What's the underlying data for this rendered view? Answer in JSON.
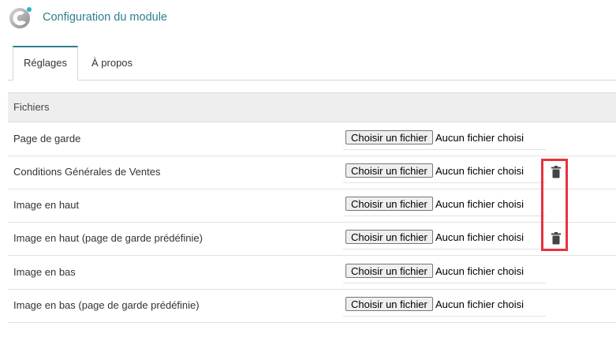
{
  "header": {
    "title": "Configuration du module",
    "logo_icon": "module-logo-icon"
  },
  "tabs": [
    {
      "label": "Réglages",
      "active": true
    },
    {
      "label": "À propos",
      "active": false
    }
  ],
  "section": {
    "title": "Fichiers"
  },
  "rows": [
    {
      "label": "Page de garde",
      "button": "Choisir un fichier",
      "status": "Aucun fichier choisi",
      "has_delete": false
    },
    {
      "label": "Conditions Générales de Ventes",
      "button": "Choisir un fichier",
      "status": "Aucun fichier choisi",
      "has_delete": true
    },
    {
      "label": "Image en haut",
      "button": "Choisir un fichier",
      "status": "Aucun fichier choisi",
      "has_delete": false
    },
    {
      "label": "Image en haut (page de garde prédéfinie)",
      "button": "Choisir un fichier",
      "status": "Aucun fichier choisi",
      "has_delete": true
    },
    {
      "label": "Image en bas",
      "button": "Choisir un fichier",
      "status": "Aucun fichier choisi",
      "has_delete": false
    },
    {
      "label": "Image en bas (page de garde prédéfinie)",
      "button": "Choisir un fichier",
      "status": "Aucun fichier choisi",
      "has_delete": false
    }
  ],
  "colors": {
    "accent": "#2f7e8c",
    "highlight": "#e8323c"
  }
}
